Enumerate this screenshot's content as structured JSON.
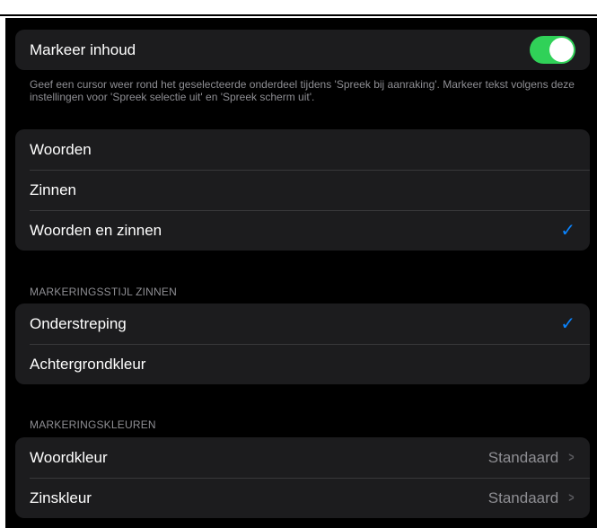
{
  "highlight": {
    "label": "Markeer inhoud",
    "toggle_on": true,
    "footer": "Geef een cursor weer rond het geselecteerde onderdeel tijdens 'Spreek bij aanraking'. Markeer tekst volgens deze instellingen voor 'Spreek selectie uit' en 'Spreek scherm uit'."
  },
  "content_options": {
    "items": [
      {
        "label": "Woorden",
        "selected": false
      },
      {
        "label": "Zinnen",
        "selected": false
      },
      {
        "label": "Woorden en zinnen",
        "selected": true
      }
    ]
  },
  "sentence_style": {
    "header": "MARKERINGSSTIJL ZINNEN",
    "items": [
      {
        "label": "Onderstreping",
        "selected": true
      },
      {
        "label": "Achtergrondkleur",
        "selected": false
      }
    ]
  },
  "colors": {
    "header": "MARKERINGSKLEUREN",
    "items": [
      {
        "label": "Woordkleur",
        "value": "Standaard"
      },
      {
        "label": "Zinskleur",
        "value": "Standaard"
      }
    ]
  },
  "theme": {
    "accent": "#0a84ff",
    "toggle_on": "#30d158",
    "background": "#000000",
    "cell": "#1c1c1e"
  }
}
